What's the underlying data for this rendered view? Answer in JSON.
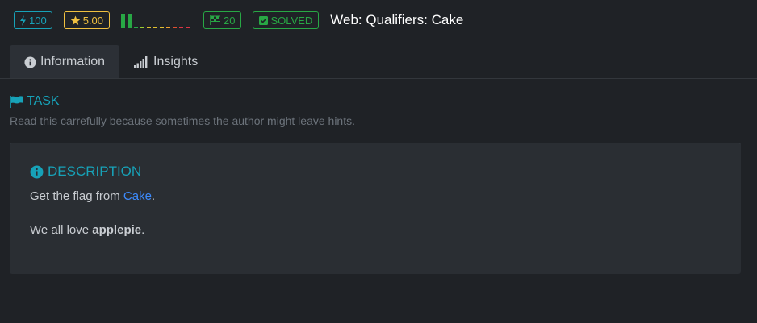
{
  "header": {
    "points": "100",
    "rating": "5.00",
    "solves": "20",
    "status": "SOLVED",
    "title": "Web: Qualifiers: Cake",
    "difficulty_segments": [
      "#28a745",
      "#28a745",
      "#28a745",
      "#9acd32",
      "#e0c030",
      "#e0c030",
      "#e0c030",
      "#f0a030",
      "#e05030",
      "#dc3545",
      "#dc3545"
    ],
    "difficulty_filled": 2,
    "colors": {
      "points": "#17a2b8",
      "rating": "#f0c040",
      "success": "#28a745"
    }
  },
  "tabs": [
    {
      "label": "Information",
      "icon": "info-circle-icon",
      "active": true
    },
    {
      "label": "Insights",
      "icon": "signal-bars-icon",
      "active": false
    }
  ],
  "task": {
    "heading": "TASK",
    "subtitle": "Read this carrefully because sometimes the author might leave hints."
  },
  "description": {
    "heading": "DESCRIPTION",
    "p1_before": "Get the flag from ",
    "p1_link": "Cake",
    "p1_after": ".",
    "p2_before": "We all love ",
    "p2_bold": "applepie",
    "p2_after": "."
  }
}
